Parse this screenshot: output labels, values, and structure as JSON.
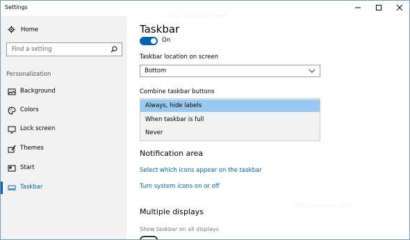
{
  "window": {
    "title": "Settings"
  },
  "sidebar": {
    "home_label": "Home",
    "search_placeholder": "Find a setting",
    "section_label": "Personalization",
    "items": [
      {
        "label": "Background",
        "icon": "image-icon"
      },
      {
        "label": "Colors",
        "icon": "palette-icon"
      },
      {
        "label": "Lock screen",
        "icon": "monitor-lock-icon"
      },
      {
        "label": "Themes",
        "icon": "brush-icon"
      },
      {
        "label": "Start",
        "icon": "start-grid-icon"
      },
      {
        "label": "Taskbar",
        "icon": "taskbar-icon",
        "active": true
      }
    ]
  },
  "main": {
    "title": "Taskbar",
    "toggle_label": "On",
    "location_label": "Taskbar location on screen",
    "location_value": "Bottom",
    "combine_label": "Combine taskbar buttons",
    "combine_options": [
      "Always, hide labels",
      "When taskbar is full",
      "Never"
    ],
    "combine_selected": "Always, hide labels",
    "notification_heading": "Notification area",
    "link_icons": "Select which icons appear on the taskbar",
    "link_system_icons": "Turn system icons on or off",
    "multiple_heading": "Multiple displays",
    "show_on_all_label": "Show taskbar on all displays"
  },
  "colors": {
    "accent": "#0063b1",
    "selected": "#99c9ef",
    "sidebar_bg": "#f2f2f2"
  },
  "watermark": "http://winaero.com"
}
